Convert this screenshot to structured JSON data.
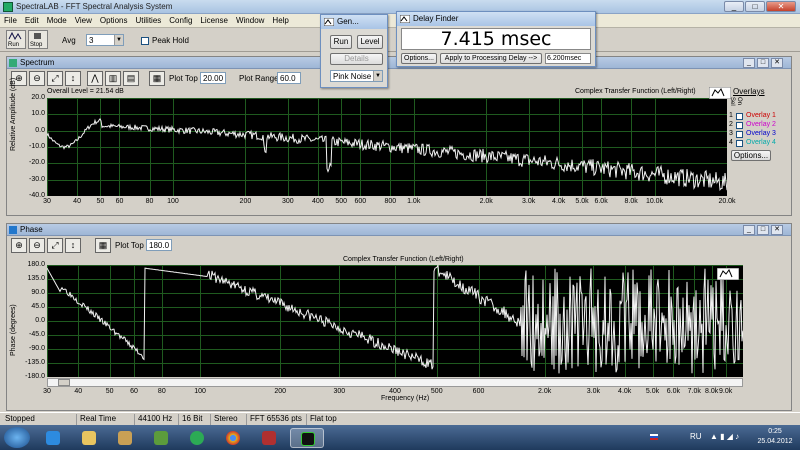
{
  "window": {
    "title": "SpectraLAB - FFT Spectral Analysis System",
    "controls": [
      "_",
      "□",
      "✕"
    ]
  },
  "menu": [
    "File",
    "Edit",
    "Mode",
    "View",
    "Options",
    "Utilities",
    "Config",
    "License",
    "Window",
    "Help"
  ],
  "toolbar": {
    "run_label": "Run",
    "stop_label": "Stop",
    "avg_label": "Avg",
    "avg_value": "3",
    "peak_hold_label": "Peak Hold"
  },
  "generator": {
    "title": "Gen...",
    "run_label": "Run",
    "level_label": "Level",
    "details_label": "Details",
    "signal_value": "Pink Noise"
  },
  "delay_finder": {
    "title": "Delay Finder",
    "readout": "7.415 msec",
    "options_label": "Options...",
    "apply_label": "Apply to Processing Delay -->",
    "delay_value": "6.200msec"
  },
  "spectrum": {
    "title": "Spectrum",
    "plot_top_label": "Plot Top",
    "plot_top_value": "20.00",
    "plot_range_label": "Plot Range",
    "plot_range_value": "60.0",
    "overall_level": "Overall Level = 21.54 dB",
    "function_label": "Complex Transfer Function (Left/Right)",
    "y_axis_label": "Relative Amplitude (dB)",
    "y_ticks": [
      "20.0",
      "10.0",
      "0.0",
      "-10.0",
      "-20.0",
      "-30.0",
      "-40.0"
    ],
    "x_ticks": [
      "30",
      "40",
      "50",
      "60",
      "80",
      "100",
      "200",
      "300",
      "400",
      "500",
      "600",
      "800",
      "1.0k",
      "2.0k",
      "3.0k",
      "4.0k",
      "5.0k",
      "6.0k",
      "8.0k",
      "10.0k",
      "20.0k"
    ],
    "overlays_title": "Overlays",
    "sel_label": "Sel",
    "on_label": "On",
    "overlays": [
      {
        "num": "1",
        "name": "Overlay 1",
        "color": "#cc0000"
      },
      {
        "num": "2",
        "name": "Overlay 2",
        "color": "#cc00cc"
      },
      {
        "num": "3",
        "name": "Overlay 3",
        "color": "#0000cc"
      },
      {
        "num": "4",
        "name": "Overlay 4",
        "color": "#00aaaa"
      }
    ],
    "options_label": "Options..."
  },
  "phase": {
    "title": "Phase",
    "plot_top_label": "Plot Top",
    "plot_top_value": "180.0",
    "function_label": "Complex Transfer Function (Left/Right)",
    "y_axis_label": "Phase (degrees)",
    "x_axis_label": "Frequency (Hz)",
    "y_ticks": [
      "180.0",
      "135.0",
      "90.0",
      "45.0",
      "0.0",
      "-45.0",
      "-90.0",
      "-135.0",
      "-180.0"
    ],
    "x_ticks": [
      "30",
      "40",
      "50",
      "60",
      "80",
      "100",
      "200",
      "300",
      "400",
      "500",
      "600",
      "2.0k",
      "3.0k",
      "4.0k",
      "5.0k",
      "6.0k",
      "7.0k",
      "8.0k",
      "9.0k"
    ]
  },
  "status": [
    "Stopped",
    "Real Time",
    "44100 Hz",
    "16 Bit",
    "Stereo",
    "FFT 65536 pts",
    "Flat top"
  ],
  "taskbar": {
    "language": "RU",
    "time": "0:25",
    "date": "25.04.2012"
  }
}
